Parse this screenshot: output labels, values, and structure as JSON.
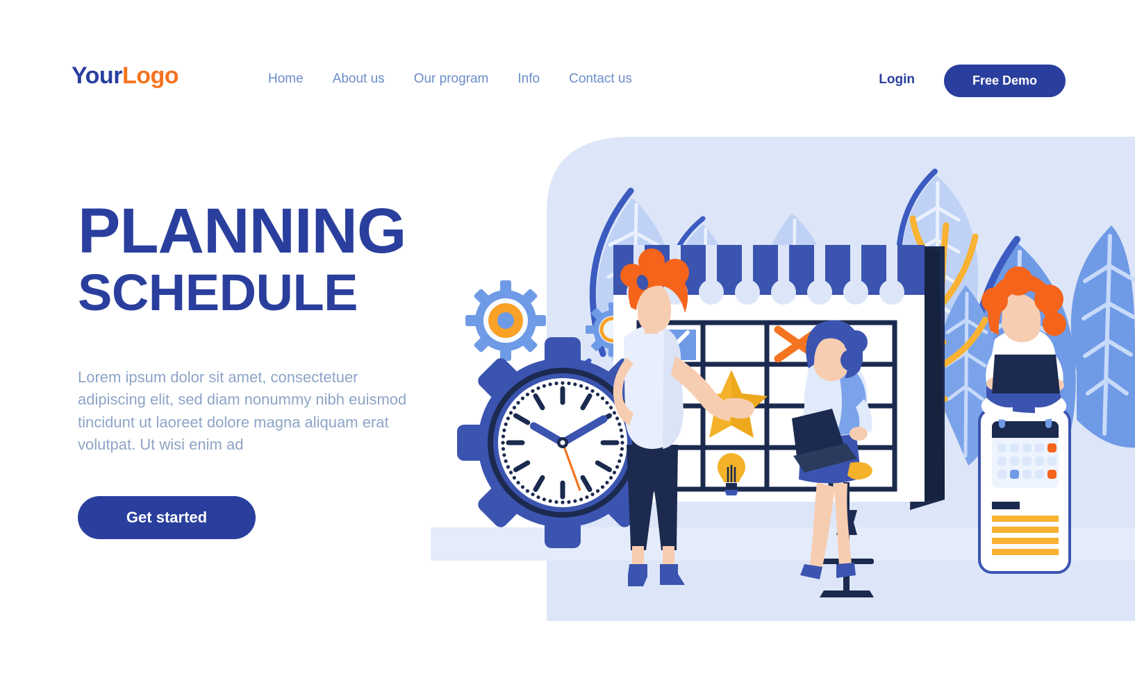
{
  "brand": {
    "logo_part1": "Your",
    "logo_part2": "Logo",
    "primary_color": "#2a3f9d",
    "accent_color": "#f4741f",
    "muted_text_color": "#8ea4c6",
    "nav_link_color": "#6a8cc9",
    "gold_color": "#f5a623",
    "light_bg_color": "#dde6f8"
  },
  "header": {
    "nav_items": [
      {
        "label": "Home"
      },
      {
        "label": "About us"
      },
      {
        "label": "Our program"
      },
      {
        "label": "Info"
      },
      {
        "label": "Contact us"
      }
    ],
    "login_label": "Login",
    "demo_label": "Free Demo"
  },
  "hero": {
    "title_line1": "PLANNING",
    "title_line2": "SCHEDULE",
    "paragraph": "Lorem ipsum dolor sit amet, consectetuer adipiscing elit, sed diam nonummy nibh euismod tincidunt ut laoreet dolore magna aliquam erat volutpat. Ut wisi enim ad",
    "cta_label": "Get started"
  },
  "illustration": {
    "alt": "Two women planning on a large wall calendar beside a clock set in a gear, with plants, gears and a smartphone showing a calendar app",
    "clock": {
      "hour_angle_deg": -60,
      "minute_angle_deg": 60,
      "second_angle_deg": 160
    },
    "calendar_marks": [
      {
        "cell": "r1c1",
        "icon": "chart-icon"
      },
      {
        "cell": "r1c3",
        "icon": "cross-icon"
      },
      {
        "cell": "r2c2",
        "icon": "star-icon"
      },
      {
        "cell": "r4c2",
        "icon": "lightbulb-icon"
      }
    ],
    "phone": {
      "calendar_dots_rows": 3,
      "calendar_dots_cols": 5,
      "accent_dots": [
        "r1c5",
        "r3c2",
        "r3c5"
      ],
      "text_lines": 4
    }
  }
}
